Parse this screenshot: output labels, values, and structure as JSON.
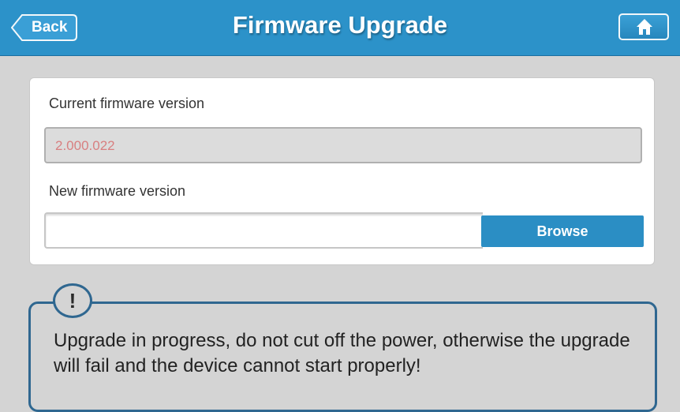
{
  "header": {
    "back_label": "Back",
    "title": "Firmware Upgrade",
    "home_icon": "home-icon"
  },
  "form": {
    "current_label": "Current firmware version",
    "current_value": "2.000.022",
    "new_label": "New firmware version",
    "new_value": "",
    "browse_label": "Browse"
  },
  "warning": {
    "icon": "exclamation",
    "icon_glyph": "!",
    "text": "Upgrade in progress, do not cut off the power, otherwise the upgrade will fail and the device cannot start properly!"
  },
  "colors": {
    "header_bg": "#2c92c9",
    "button_bg": "#2b8ec4",
    "page_bg": "#d4d4d4",
    "current_value_text": "#d87f80",
    "warning_border": "#2f6790"
  }
}
